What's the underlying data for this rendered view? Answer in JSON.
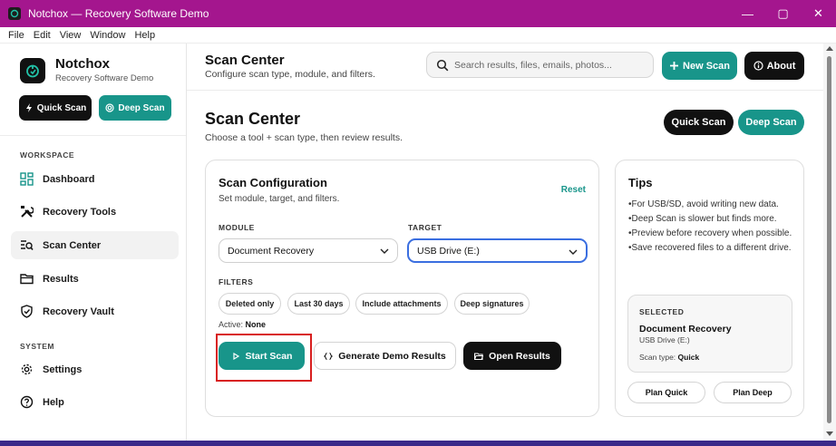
{
  "window": {
    "title": "Notchox — Recovery Software Demo",
    "controls": {
      "minimize": "—",
      "maximize": "▢",
      "close": "✕"
    }
  },
  "menu": [
    "File",
    "Edit",
    "View",
    "Window",
    "Help"
  ],
  "brand": {
    "name": "Notchox",
    "subtitle": "Recovery Software Demo"
  },
  "sidebar": {
    "quick_scan": "Quick Scan",
    "deep_scan": "Deep Scan",
    "sections": {
      "workspace": "WORKSPACE",
      "system": "SYSTEM"
    },
    "items": [
      {
        "label": "Dashboard",
        "icon": "dashboard-icon"
      },
      {
        "label": "Recovery Tools",
        "icon": "tools-icon"
      },
      {
        "label": "Scan Center",
        "icon": "scan-list-icon",
        "active": true
      },
      {
        "label": "Results",
        "icon": "folder-icon"
      },
      {
        "label": "Recovery Vault",
        "icon": "shield-icon"
      },
      {
        "label": "Settings",
        "icon": "gear-icon"
      },
      {
        "label": "Help",
        "icon": "help-icon"
      }
    ]
  },
  "header": {
    "title": "Scan Center",
    "subtitle": "Configure scan type, module, and filters.",
    "search_placeholder": "Search results, files, emails, photos...",
    "new_scan": "New Scan",
    "about": "About"
  },
  "page": {
    "title": "Scan Center",
    "subtitle": "Choose a tool + scan type, then review results.",
    "quick_scan": "Quick Scan",
    "deep_scan": "Deep Scan"
  },
  "config": {
    "title": "Scan Configuration",
    "subtitle": "Set module, target, and filters.",
    "reset": "Reset",
    "module_label": "MODULE",
    "module_value": "Document Recovery",
    "target_label": "TARGET",
    "target_value": "USB Drive (E:)",
    "filters_label": "FILTERS",
    "filters": [
      "Deleted only",
      "Last 30 days",
      "Include attachments",
      "Deep signatures"
    ],
    "active_label": "Active:",
    "active_value": "None",
    "start_scan": "Start Scan",
    "generate_demo": "Generate Demo Results",
    "open_results": "Open Results"
  },
  "tips": {
    "title": "Tips",
    "items": [
      "For USB/SD, avoid writing new data.",
      "Deep Scan is slower but finds more.",
      "Preview before recovery when possible.",
      "Save recovered files to a different drive."
    ],
    "selected_label": "SELECTED",
    "selected_name": "Document Recovery",
    "selected_target": "USB Drive (E:)",
    "scan_type_label": "Scan type:",
    "scan_type_value": "Quick",
    "plan_quick": "Plan Quick",
    "plan_deep": "Plan Deep"
  },
  "colors": {
    "accent": "#18958a",
    "titlebar": "#a4168e",
    "dark": "#111111",
    "highlight": "#d81f1f",
    "focus": "#3a6ee0"
  }
}
